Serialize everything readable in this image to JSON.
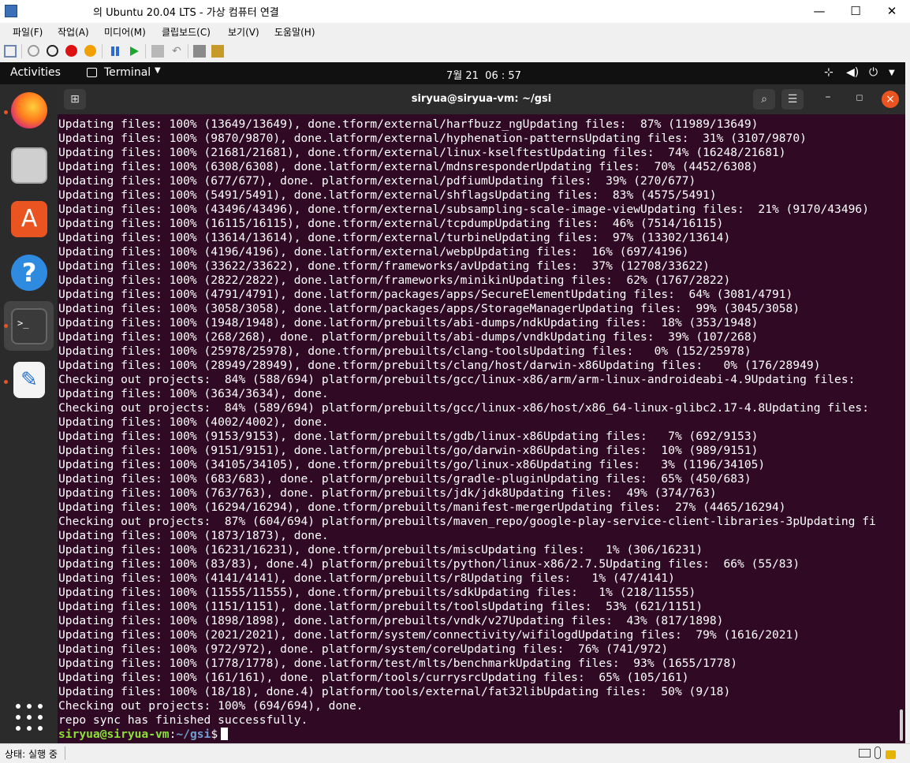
{
  "window": {
    "title": "의 Ubuntu 20.04 LTS - 가상 컴퓨터 연결",
    "minimize": "—",
    "maximize": "☐",
    "close": "✕"
  },
  "menu": [
    "파일(F)",
    "작업(A)",
    "미디어(M)",
    "클립보드(C)",
    "보기(V)",
    "도움말(H)"
  ],
  "gnome": {
    "activities": "Activities",
    "app_menu": "Terminal",
    "clock": "7월 21  06 : 57"
  },
  "terminal": {
    "title": "siryua@siryua-vm: ~/gsi",
    "lines": [
      "Updating files: 100% (13649/13649), done.tform/external/harfbuzz_ngUpdating files:  87% (11989/13649)",
      "Updating files: 100% (9870/9870), done.latform/external/hyphenation-patternsUpdating files:  31% (3107/9870)",
      "Updating files: 100% (21681/21681), done.tform/external/linux-kselftestUpdating files:  74% (16248/21681)",
      "Updating files: 100% (6308/6308), done.latform/external/mdnsresponderUpdating files:  70% (4452/6308)",
      "Updating files: 100% (677/677), done. platform/external/pdfiumUpdating files:  39% (270/677)",
      "Updating files: 100% (5491/5491), done.latform/external/shflagsUpdating files:  83% (4575/5491)",
      "Updating files: 100% (43496/43496), done.tform/external/subsampling-scale-image-viewUpdating files:  21% (9170/43496)",
      "Updating files: 100% (16115/16115), done.tform/external/tcpdumpUpdating files:  46% (7514/16115)",
      "Updating files: 100% (13614/13614), done.tform/external/turbineUpdating files:  97% (13302/13614)",
      "Updating files: 100% (4196/4196), done.latform/external/webpUpdating files:  16% (697/4196)",
      "Updating files: 100% (33622/33622), done.tform/frameworks/avUpdating files:  37% (12708/33622)",
      "Updating files: 100% (2822/2822), done.latform/frameworks/minikinUpdating files:  62% (1767/2822)",
      "Updating files: 100% (4791/4791), done.latform/packages/apps/SecureElementUpdating files:  64% (3081/4791)",
      "Updating files: 100% (3058/3058), done.latform/packages/apps/StorageManagerUpdating files:  99% (3045/3058)",
      "Updating files: 100% (1948/1948), done.latform/prebuilts/abi-dumps/ndkUpdating files:  18% (353/1948)",
      "Updating files: 100% (268/268), done. platform/prebuilts/abi-dumps/vndkUpdating files:  39% (107/268)",
      "Updating files: 100% (25978/25978), done.tform/prebuilts/clang-toolsUpdating files:   0% (152/25978)",
      "Updating files: 100% (28949/28949), done.tform/prebuilts/clang/host/darwin-x86Updating files:   0% (176/28949)",
      "Checking out projects:  84% (588/694) platform/prebuilts/gcc/linux-x86/arm/arm-linux-androideabi-4.9Updating files:",
      "Updating files: 100% (3634/3634), done.",
      "Checking out projects:  84% (589/694) platform/prebuilts/gcc/linux-x86/host/x86_64-linux-glibc2.17-4.8Updating files:",
      "Updating files: 100% (4002/4002), done.",
      "Updating files: 100% (9153/9153), done.latform/prebuilts/gdb/linux-x86Updating files:   7% (692/9153)",
      "Updating files: 100% (9151/9151), done.latform/prebuilts/go/darwin-x86Updating files:  10% (989/9151)",
      "Updating files: 100% (34105/34105), done.tform/prebuilts/go/linux-x86Updating files:   3% (1196/34105)",
      "Updating files: 100% (683/683), done. platform/prebuilts/gradle-pluginUpdating files:  65% (450/683)",
      "Updating files: 100% (763/763), done. platform/prebuilts/jdk/jdk8Updating files:  49% (374/763)",
      "Updating files: 100% (16294/16294), done.tform/prebuilts/manifest-mergerUpdating files:  27% (4465/16294)",
      "Checking out projects:  87% (604/694) platform/prebuilts/maven_repo/google-play-service-client-libraries-3pUpdating fi",
      "Updating files: 100% (1873/1873), done.",
      "Updating files: 100% (16231/16231), done.tform/prebuilts/miscUpdating files:   1% (306/16231)",
      "Updating files: 100% (83/83), done.4) platform/prebuilts/python/linux-x86/2.7.5Updating files:  66% (55/83)",
      "Updating files: 100% (4141/4141), done.latform/prebuilts/r8Updating files:   1% (47/4141)",
      "Updating files: 100% (11555/11555), done.tform/prebuilts/sdkUpdating files:   1% (218/11555)",
      "Updating files: 100% (1151/1151), done.latform/prebuilts/toolsUpdating files:  53% (621/1151)",
      "Updating files: 100% (1898/1898), done.latform/prebuilts/vndk/v27Updating files:  43% (817/1898)",
      "Updating files: 100% (2021/2021), done.latform/system/connectivity/wifilogdUpdating files:  79% (1616/2021)",
      "Updating files: 100% (972/972), done. platform/system/coreUpdating files:  76% (741/972)",
      "Updating files: 100% (1778/1778), done.latform/test/mlts/benchmarkUpdating files:  93% (1655/1778)",
      "Updating files: 100% (161/161), done. platform/tools/currysrcUpdating files:  65% (105/161)",
      "Updating files: 100% (18/18), done.4) platform/tools/external/fat32libUpdating files:  50% (9/18)",
      "Checking out projects: 100% (694/694), done.",
      "repo sync has finished successfully."
    ],
    "prompt_user": "siryua@siryua-vm",
    "prompt_sep": ":",
    "prompt_path": "~/gsi",
    "prompt_symbol": "$"
  },
  "status": {
    "text": "상태: 실행 중"
  }
}
